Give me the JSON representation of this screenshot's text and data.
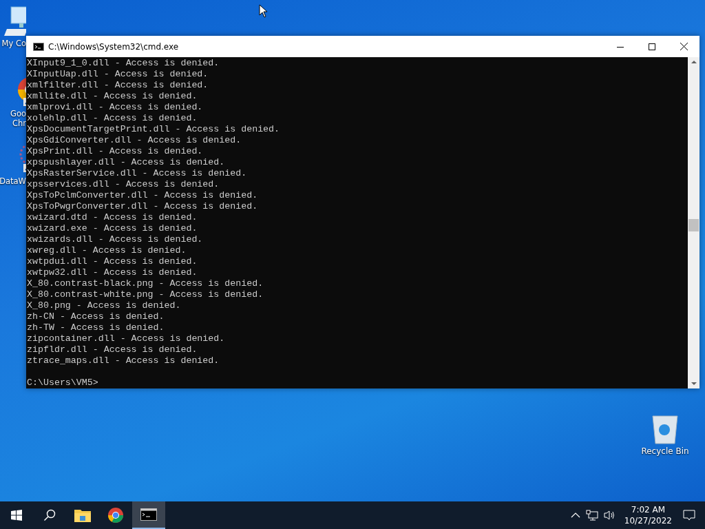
{
  "desktop_icons": [
    {
      "label": "My Co",
      "kind": "computer"
    },
    {
      "label": "Goo\nChr",
      "kind": "browser"
    },
    {
      "label": "DataW",
      "kind": "app"
    },
    {
      "label": "Recycle Bin",
      "kind": "bin"
    }
  ],
  "window": {
    "title": "C:\\Windows\\System32\\cmd.exe"
  },
  "console_lines": [
    "XInput9_1_0.dll - Access is denied.",
    "XInputUap.dll - Access is denied.",
    "xmlfilter.dll - Access is denied.",
    "xmllite.dll - Access is denied.",
    "xmlprovi.dll - Access is denied.",
    "xolehlp.dll - Access is denied.",
    "XpsDocumentTargetPrint.dll - Access is denied.",
    "XpsGdiConverter.dll - Access is denied.",
    "XpsPrint.dll - Access is denied.",
    "xpspushlayer.dll - Access is denied.",
    "XpsRasterService.dll - Access is denied.",
    "xpsservices.dll - Access is denied.",
    "XpsToPclmConverter.dll - Access is denied.",
    "XpsToPwgrConverter.dll - Access is denied.",
    "xwizard.dtd - Access is denied.",
    "xwizard.exe - Access is denied.",
    "xwizards.dll - Access is denied.",
    "xwreg.dll - Access is denied.",
    "xwtpdui.dll - Access is denied.",
    "xwtpw32.dll - Access is denied.",
    "X_80.contrast-black.png - Access is denied.",
    "X_80.contrast-white.png - Access is denied.",
    "X_80.png - Access is denied.",
    "zh-CN - Access is denied.",
    "zh-TW - Access is denied.",
    "zipcontainer.dll - Access is denied.",
    "zipfldr.dll - Access is denied.",
    "ztrace_maps.dll - Access is denied."
  ],
  "prompt": "C:\\Users\\VM5>",
  "taskbar": {
    "apps": [
      {
        "kind": "folder",
        "selected": false
      },
      {
        "kind": "browser",
        "selected": false
      },
      {
        "kind": "terminal",
        "selected": true
      }
    ],
    "time": "7:02 AM",
    "date": "10/27/2022"
  }
}
